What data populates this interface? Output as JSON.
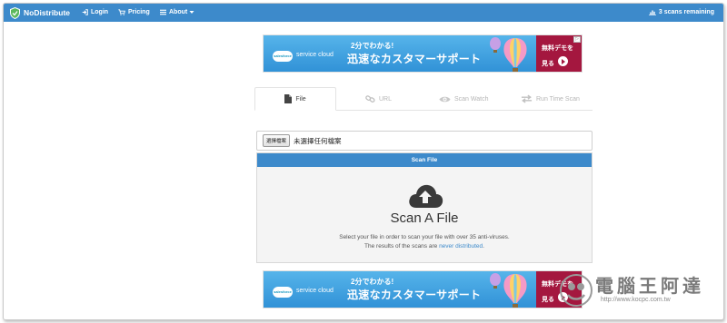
{
  "navbar": {
    "brand": "NoDistribute",
    "login": "Login",
    "pricing": "Pricing",
    "about": "About",
    "scans_remaining": "3 scans remaining",
    "color": "#3d8acb"
  },
  "ad": {
    "headline": "2分でわかる!",
    "main": "迅速なカスタマーサポート",
    "cta_line1": "無料デモを",
    "cta_line2": "見る",
    "brand": "salesforce",
    "product": "service cloud"
  },
  "tabs": [
    {
      "label": "File",
      "icon": "file-icon",
      "active": true
    },
    {
      "label": "URL",
      "icon": "link-icon",
      "active": false
    },
    {
      "label": "Scan Watch",
      "icon": "eye-icon",
      "active": false
    },
    {
      "label": "Run Time Scan",
      "icon": "exchange-icon",
      "active": false
    }
  ],
  "file_input": {
    "button_label": "選擇檔案",
    "status": "未選擇任何檔案"
  },
  "scan_panel": {
    "header": "Scan File",
    "title": "Scan A File",
    "desc_line1": "Select your file in order to scan your file with over 35 anti-viruses.",
    "desc_line2_prefix": "The results of the scans are ",
    "desc_line2_link": "never distributed",
    "desc_line2_suffix": ".",
    "icon": "cloud-upload-icon"
  },
  "watermark": {
    "text": "電腦王阿達",
    "url": "http://www.kocpc.com.tw"
  }
}
